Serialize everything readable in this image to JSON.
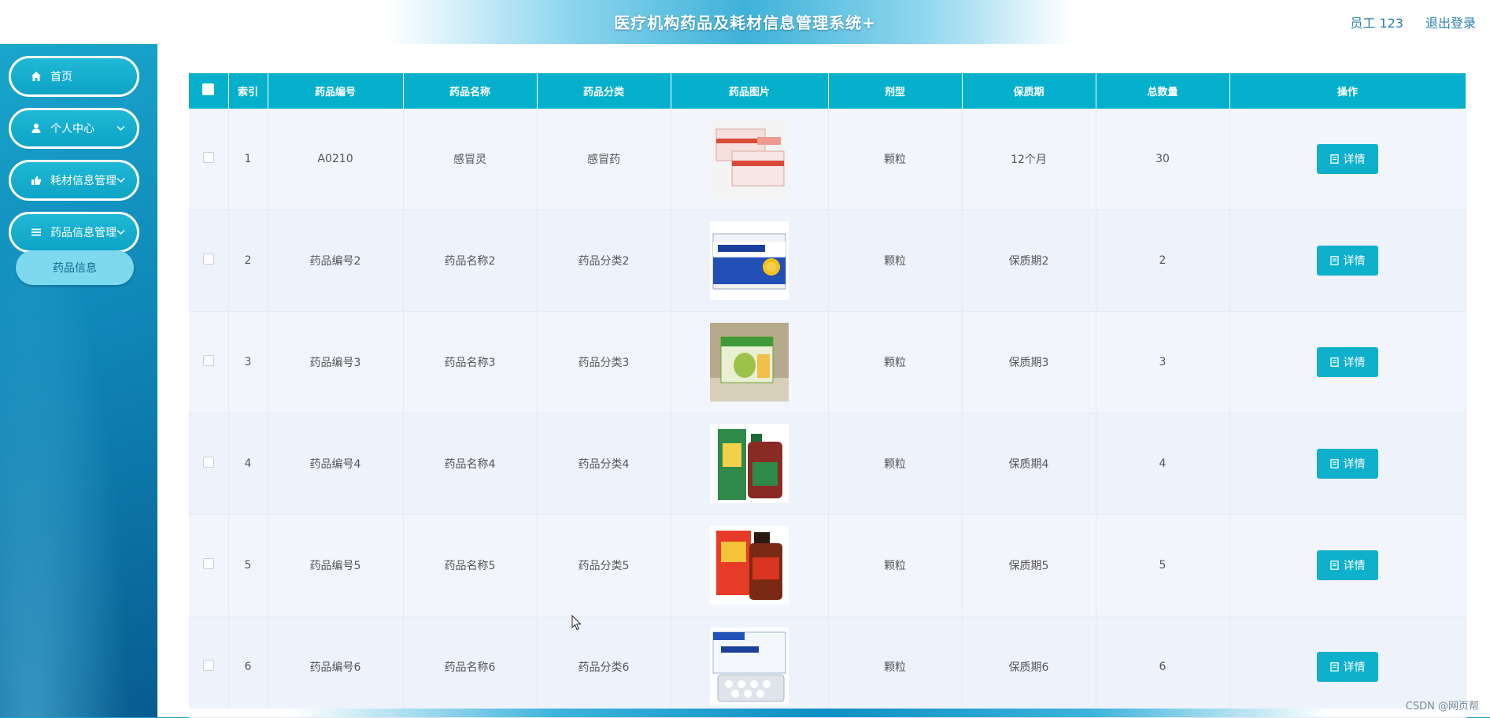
{
  "header": {
    "title": "医疗机构药品及耗材信息管理系统+",
    "user": "员工 123",
    "logout": "退出登录"
  },
  "sidebar": {
    "items": [
      {
        "label": "首页",
        "icon": "home-icon"
      },
      {
        "label": "个人中心",
        "icon": "user-icon"
      },
      {
        "label": "耗材信息管理",
        "icon": "thumbs-up-icon"
      },
      {
        "label": "药品信息管理",
        "icon": "list-icon"
      }
    ],
    "submenu": {
      "label": "药品信息"
    }
  },
  "table": {
    "columns": [
      "索引",
      "药品编号",
      "药品名称",
      "药品分类",
      "药品图片",
      "剂型",
      "保质期",
      "总数量",
      "操作"
    ],
    "rows": [
      {
        "index": "1",
        "code": "A0210",
        "name": "感冒灵",
        "category": "感冒药",
        "form": "颗粒",
        "shelf_life": "12个月",
        "quantity": "30",
        "action": "详情"
      },
      {
        "index": "2",
        "code": "药品编号2",
        "name": "药品名称2",
        "category": "药品分类2",
        "form": "颗粒",
        "shelf_life": "保质期2",
        "quantity": "2",
        "action": "详情"
      },
      {
        "index": "3",
        "code": "药品编号3",
        "name": "药品名称3",
        "category": "药品分类3",
        "form": "颗粒",
        "shelf_life": "保质期3",
        "quantity": "3",
        "action": "详情"
      },
      {
        "index": "4",
        "code": "药品编号4",
        "name": "药品名称4",
        "category": "药品分类4",
        "form": "颗粒",
        "shelf_life": "保质期4",
        "quantity": "4",
        "action": "详情"
      },
      {
        "index": "5",
        "code": "药品编号5",
        "name": "药品名称5",
        "category": "药品分类5",
        "form": "颗粒",
        "shelf_life": "保质期5",
        "quantity": "5",
        "action": "详情"
      },
      {
        "index": "6",
        "code": "药品编号6",
        "name": "药品名称6",
        "category": "药品分类6",
        "form": "颗粒",
        "shelf_life": "保质期6",
        "quantity": "6",
        "action": "详情"
      }
    ]
  },
  "colors": {
    "accent": "#05b0cc",
    "sidebar": "#0f86b7"
  },
  "watermark": "CSDN @网页帮"
}
